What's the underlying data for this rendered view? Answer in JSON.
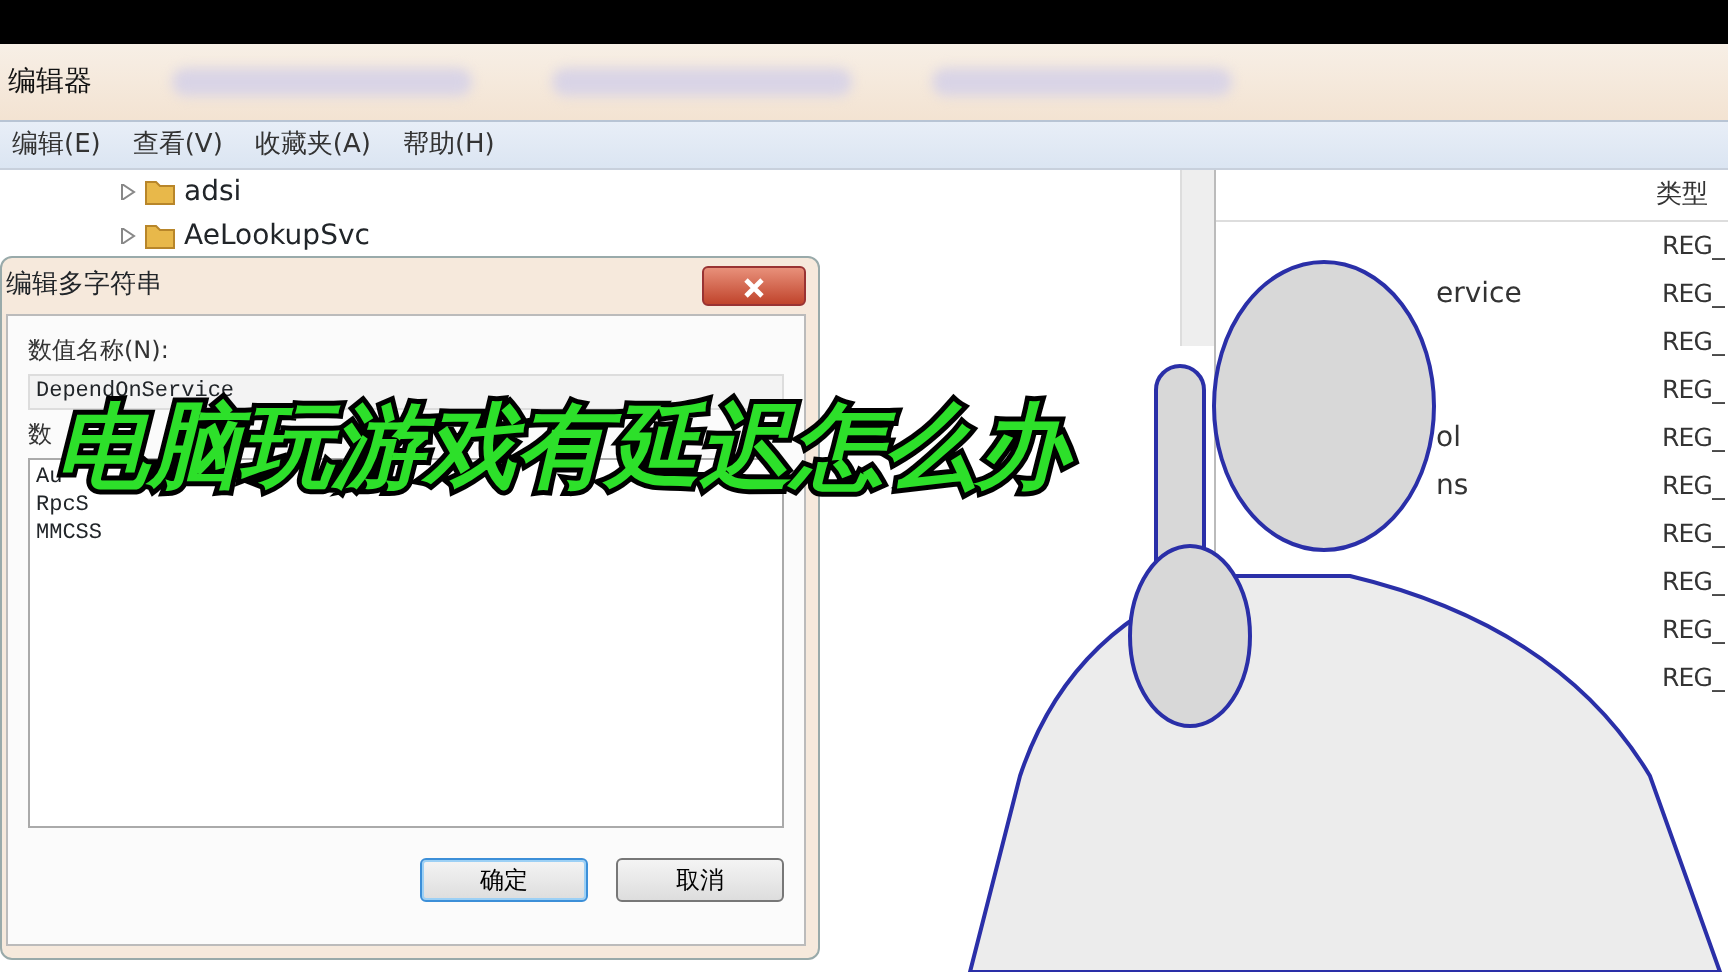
{
  "window": {
    "title": "编辑器"
  },
  "menu": [
    {
      "label": "编辑(E)"
    },
    {
      "label": "查看(V)"
    },
    {
      "label": "收藏夹(A)"
    },
    {
      "label": "帮助(H)"
    }
  ],
  "tree": {
    "items": [
      {
        "label": "adsi",
        "expanded": false
      },
      {
        "label": "AeLookupSvc",
        "expanded": false
      }
    ]
  },
  "list": {
    "column_type": "类型",
    "rows": [
      {
        "type": "REG_"
      },
      {
        "name": "ervice",
        "type": "REG_"
      },
      {
        "type": "REG_"
      },
      {
        "type": "REG_"
      },
      {
        "name": "ol",
        "type": "REG_"
      },
      {
        "name": "ns",
        "type": "REG_"
      },
      {
        "type": "REG_"
      },
      {
        "type": "REG_"
      },
      {
        "type": "REG_"
      },
      {
        "type": "REG_"
      }
    ]
  },
  "dialog": {
    "title": "编辑多字符串",
    "value_name_label": "数值名称(N):",
    "value_name": "DependOnService",
    "value_data_label": "数",
    "value_data_lines": [
      "Au",
      "RpcS",
      "MMCSS"
    ],
    "buttons": [
      {
        "label": "确定",
        "default": true
      },
      {
        "label": "取消",
        "default": false
      }
    ]
  },
  "caption": "电脑玩游戏有延迟怎么办"
}
